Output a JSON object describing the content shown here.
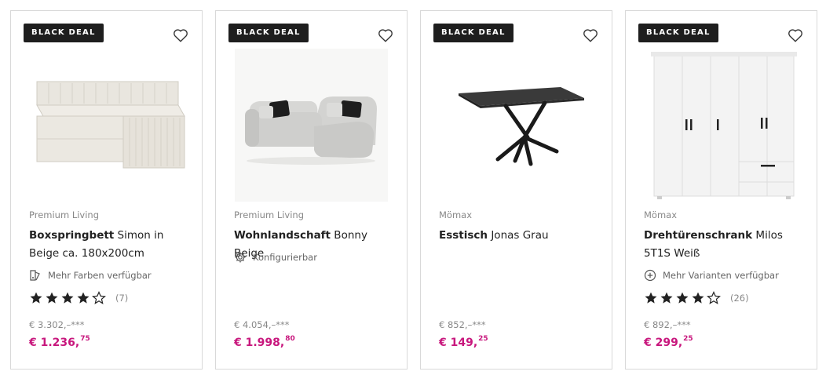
{
  "products": [
    {
      "badge": "BLACK DEAL",
      "image": "boxspring-bed",
      "brand": "Premium Living",
      "title_bold": "Boxspringbett",
      "title_rest": " Simon in Beige ca. 180x200cm",
      "feature_icon": "color-swatch-icon",
      "feature_text": "Mehr Farben verfügbar",
      "rating": 4,
      "rating_count": "(7)",
      "old_price": "€ 3.302,–***",
      "price_main": "€ 1.236,",
      "price_cents": "75"
    },
    {
      "badge": "BLACK DEAL",
      "image": "corner-sofa",
      "brand": "Premium Living",
      "title_bold": "Wohnlandschaft",
      "title_rest": " Bonny Beige",
      "feature_icon": "gear-icon",
      "feature_text": "Konfigurierbar",
      "old_price": "€ 4.054,–***",
      "price_main": "€ 1.998,",
      "price_cents": "80"
    },
    {
      "badge": "BLACK DEAL",
      "image": "dining-table",
      "brand": "Mömax",
      "title_bold": "Esstisch",
      "title_rest": " Jonas Grau",
      "old_price": "€ 852,–***",
      "price_main": "€ 149,",
      "price_cents": "25"
    },
    {
      "badge": "BLACK DEAL",
      "image": "wardrobe",
      "brand": "Mömax",
      "title_bold": "Drehtürenschrank",
      "title_rest": " Milos 5T1S Weiß",
      "feature_icon": "plus-circle-icon",
      "feature_text": "Mehr Varianten verfügbar",
      "rating": 4,
      "rating_count": "(26)",
      "old_price": "€ 892,–***",
      "price_main": "€ 299,",
      "price_cents": "25"
    }
  ],
  "colors": {
    "price": "#c8177d",
    "badge_bg": "#1e1e1e",
    "border": "#d9d9d9"
  }
}
